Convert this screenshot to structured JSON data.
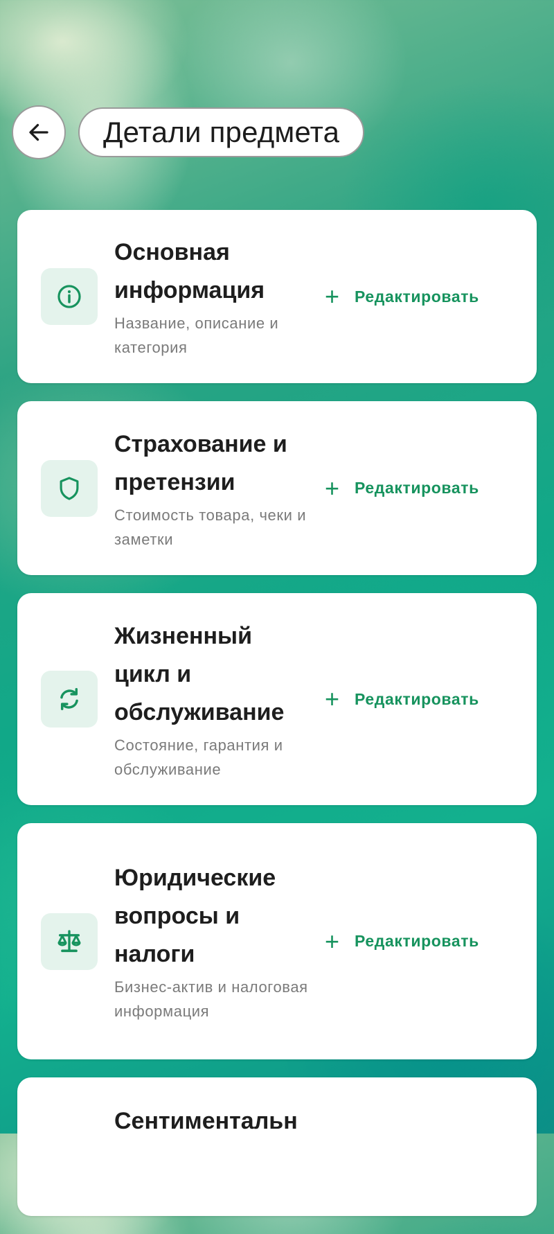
{
  "header": {
    "back_icon": "arrow-left-icon",
    "title": "Детали предмета"
  },
  "colors": {
    "accent": "#17935e",
    "icon_bg": "#e4f3ec",
    "card_bg": "#ffffff"
  },
  "sections": [
    {
      "icon": "info-icon",
      "title": "Основная информация",
      "subtitle": "Название, описание и категория",
      "action": "Редактировать"
    },
    {
      "icon": "shield-icon",
      "title": "Страхование и претензии",
      "subtitle": "Стоимость товара, чеки и заметки",
      "action": "Редактировать"
    },
    {
      "icon": "refresh-icon",
      "title": "Жизненный цикл и обслуживание",
      "subtitle": "Состояние, гарантия и обслуживание",
      "action": "Редактировать"
    },
    {
      "icon": "scale-icon",
      "title": "Юридические вопросы и налоги",
      "subtitle": "Бизнес-актив и налоговая информация",
      "action": "Редактировать"
    },
    {
      "title": "Сентиментальн"
    }
  ]
}
